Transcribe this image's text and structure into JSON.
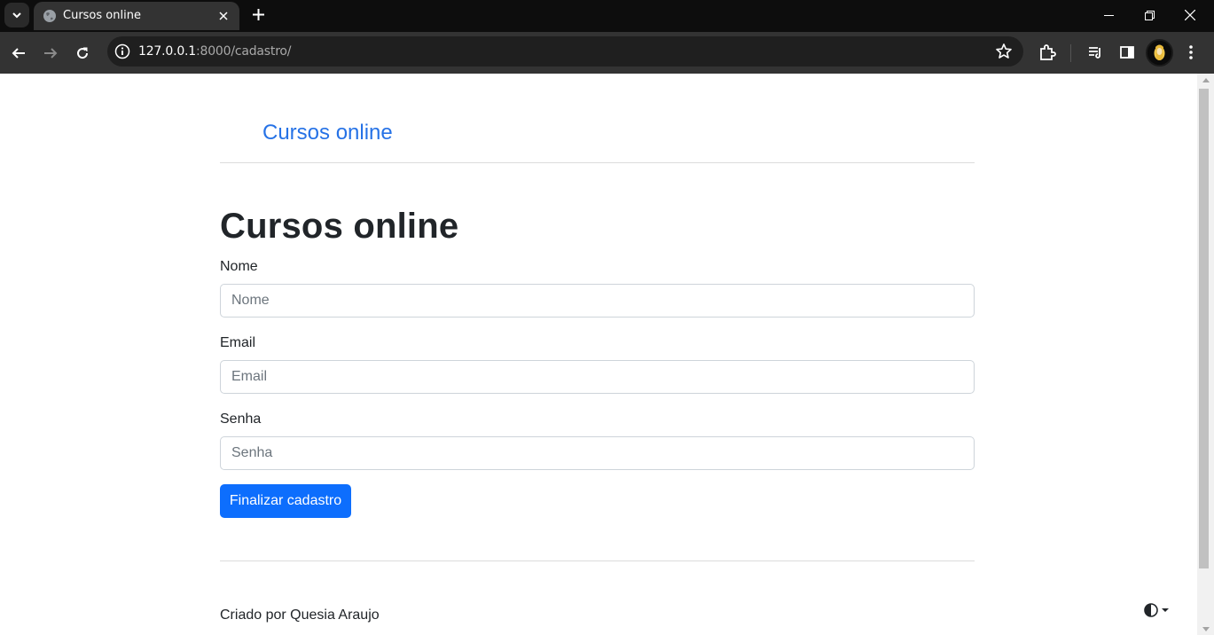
{
  "browser": {
    "tab_title": "Cursos online",
    "url_host": "127.0.0.1",
    "url_rest": ":8000/cadastro/"
  },
  "page": {
    "brand": "Cursos online",
    "title": "Cursos online",
    "form": {
      "nome_label": "Nome",
      "nome_placeholder": "Nome",
      "email_label": "Email",
      "email_placeholder": "Email",
      "senha_label": "Senha",
      "senha_placeholder": "Senha",
      "submit_label": "Finalizar cadastro"
    },
    "footer": "Criado por Quesia Araujo"
  },
  "colors": {
    "link": "#2672e6",
    "primary": "#0d6efd"
  }
}
